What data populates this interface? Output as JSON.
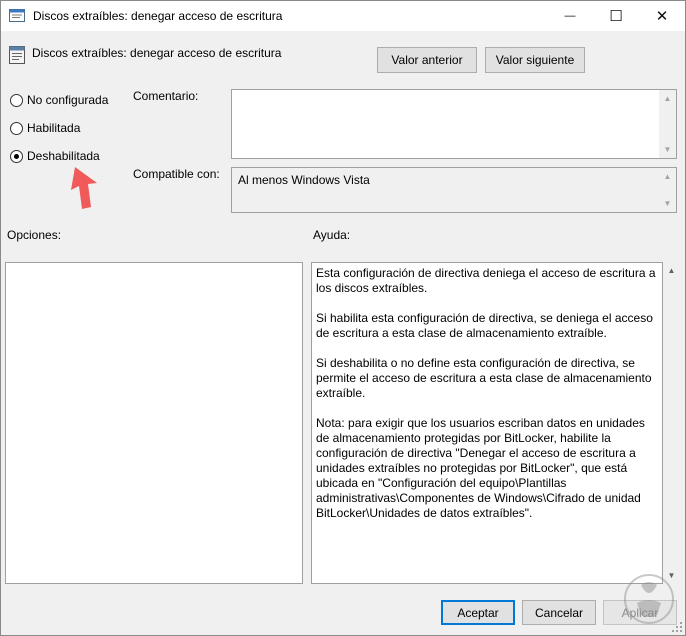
{
  "window": {
    "title": "Discos extraíbles: denegar acceso de escritura",
    "minimize_glyph": "—",
    "maximize_glyph": "☐",
    "close_glyph": "✕"
  },
  "header": {
    "policy_title": "Discos extraíbles: denegar acceso de escritura",
    "prev_button": "Valor anterior",
    "next_button": "Valor siguiente"
  },
  "state": {
    "options": [
      {
        "label": "No configurada",
        "selected": false
      },
      {
        "label": "Habilitada",
        "selected": false
      },
      {
        "label": "Deshabilitada",
        "selected": true
      }
    ]
  },
  "fields": {
    "comment_label": "Comentario:",
    "comment_value": "",
    "supported_label": "Compatible con:",
    "supported_value": "Al menos Windows Vista"
  },
  "sections": {
    "options_label": "Opciones:",
    "help_label": "Ayuda:"
  },
  "help": {
    "text": "Esta configuración de directiva deniega el acceso de escritura a los discos extraíbles.\n\nSi habilita esta configuración de directiva, se deniega el acceso de escritura a esta clase de almacenamiento extraíble.\n\nSi deshabilita o no define esta configuración de directiva, se permite el acceso de escritura a esta clase de almacenamiento extraíble.\n\nNota: para exigir que los usuarios escriban datos en unidades de almacenamiento protegidas por BitLocker, habilite la configuración de directiva \"Denegar el acceso de escritura a unidades extraíbles no protegidas por BitLocker\", que está ubicada en \"Configuración del equipo\\Plantillas administrativas\\Componentes de Windows\\Cifrado de unidad BitLocker\\Unidades de datos extraíbles\"."
  },
  "footer": {
    "ok_button": "Aceptar",
    "cancel_button": "Cancelar",
    "apply_button": "Aplicar"
  },
  "colors": {
    "annotation_arrow": "#f05a5a",
    "default_button_border": "#0078d7"
  }
}
